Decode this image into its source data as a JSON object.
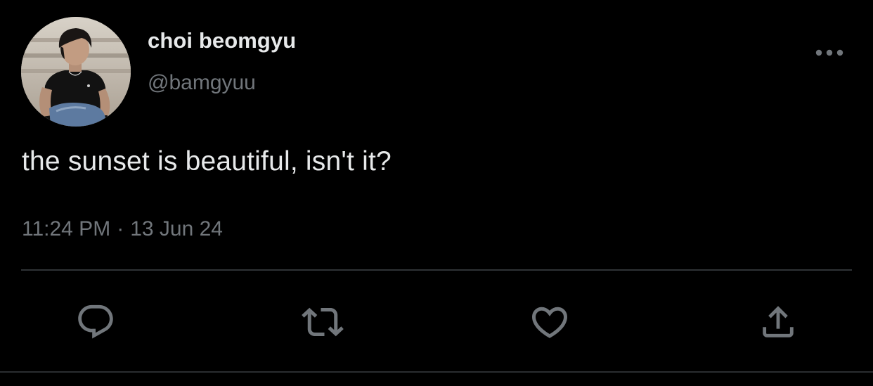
{
  "user": {
    "display_name": "choi beomgyu",
    "handle": "@bamgyuu",
    "avatar_icon": "profile-photo"
  },
  "tweet": {
    "text": "the sunset is beautiful, isn't it?",
    "time": "11:24 PM",
    "separator": "·",
    "date": "13 Jun 24"
  },
  "actions": {
    "reply_icon": "reply-icon",
    "retweet_icon": "retweet-icon",
    "like_icon": "heart-icon",
    "share_icon": "share-icon",
    "more_icon": "more-options-icon"
  },
  "colors": {
    "background": "#000000",
    "primary_text": "#e7e9ea",
    "secondary_text": "#71767b",
    "divider": "#2f3336"
  }
}
